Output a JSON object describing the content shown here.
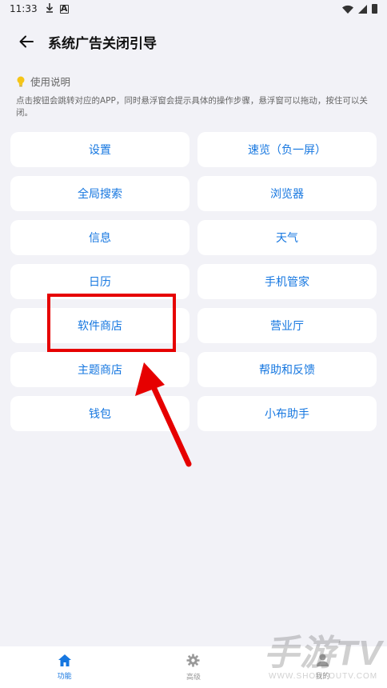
{
  "status_bar": {
    "time": "11:33"
  },
  "header": {
    "title": "系统广告关闭引导"
  },
  "usage": {
    "title": "使用说明",
    "description": "点击按钮会跳转对应的APP，同时悬浮窗会提示具体的操作步骤，悬浮窗可以拖动，按住可以关闭。"
  },
  "tiles": [
    "设置",
    "速览（负一屏）",
    "全局搜索",
    "浏览器",
    "信息",
    "天气",
    "日历",
    "手机管家",
    "软件商店",
    "营业厅",
    "主题商店",
    "帮助和反馈",
    "钱包",
    "小布助手"
  ],
  "tabs": [
    {
      "label": "功能",
      "icon": "home-icon"
    },
    {
      "label": "高级",
      "icon": "gear-icon"
    },
    {
      "label": "我的",
      "icon": "person-icon"
    }
  ],
  "watermark": {
    "main": "手游TV",
    "sub": "WWW.SHOUYOUTV.COM"
  },
  "colors": {
    "accent": "#1677E0",
    "background": "#F2F2F7",
    "annotation": "#E60000"
  }
}
